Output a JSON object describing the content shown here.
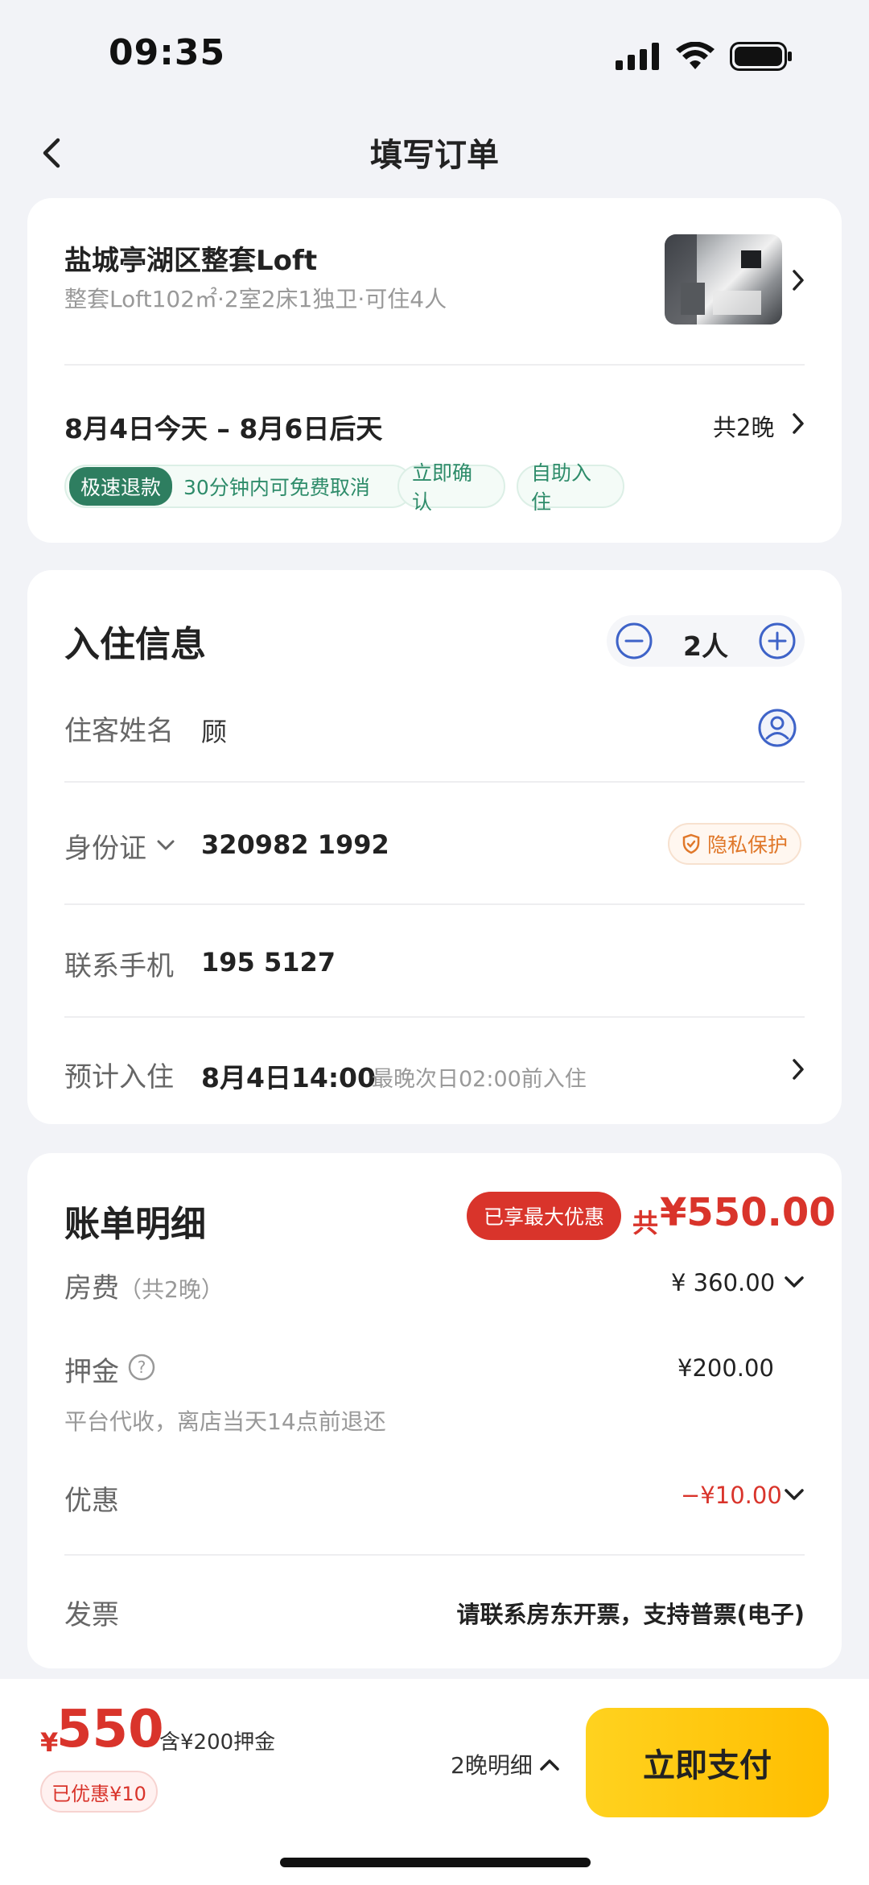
{
  "status": {
    "time": "09:35"
  },
  "nav": {
    "title": "填写订单"
  },
  "listing": {
    "title": "盐城亭湖区整套Loft",
    "subtitle": "整套Loft102㎡·2室2床1独卫·可住4人",
    "dates": "8月4日今天 – 8月6日后天",
    "nights": "共2晚",
    "tags": {
      "refund_tag": "极速退款",
      "refund_desc": "30分钟内可免费取消",
      "confirm": "立即确认",
      "self_checkin": "自助入住"
    }
  },
  "checkin": {
    "title": "入住信息",
    "guest_count": "2人",
    "name_label": "住客姓名",
    "name_value": "顾",
    "id_label": "身份证",
    "id_value": "320982 1992",
    "privacy": "隐私保护",
    "phone_label": "联系手机",
    "phone_value": "195 5127",
    "eta_label": "预计入住",
    "eta_value": "8月4日14:00",
    "eta_hint": "最晚次日02:00前入住"
  },
  "bill": {
    "title": "账单明细",
    "best_badge": "已享最大优惠",
    "total_prefix": "共",
    "total": "¥550.00",
    "room_label": "房费",
    "room_nights": "（共2晚）",
    "room_value": "¥ 360.00",
    "deposit_label": "押金",
    "deposit_value": "¥200.00",
    "deposit_note": "平台代收，离店当天14点前退还",
    "discount_label": "优惠",
    "discount_value": "−¥10.00",
    "invoice_label": "发票",
    "invoice_value": "请联系房东开票，支持普票(电子)"
  },
  "footer": {
    "currency": "¥",
    "price": "550",
    "deposit_included": "含¥200押金",
    "saved": "已优惠¥10",
    "details": "2晚明细",
    "pay": "立即支付"
  },
  "colors": {
    "accent_red": "#D9342B",
    "green": "#2E8C6A",
    "pay_yellow": "#FFC300",
    "blue_icon": "#3E63C8",
    "privacy_orange": "#E0782A"
  }
}
